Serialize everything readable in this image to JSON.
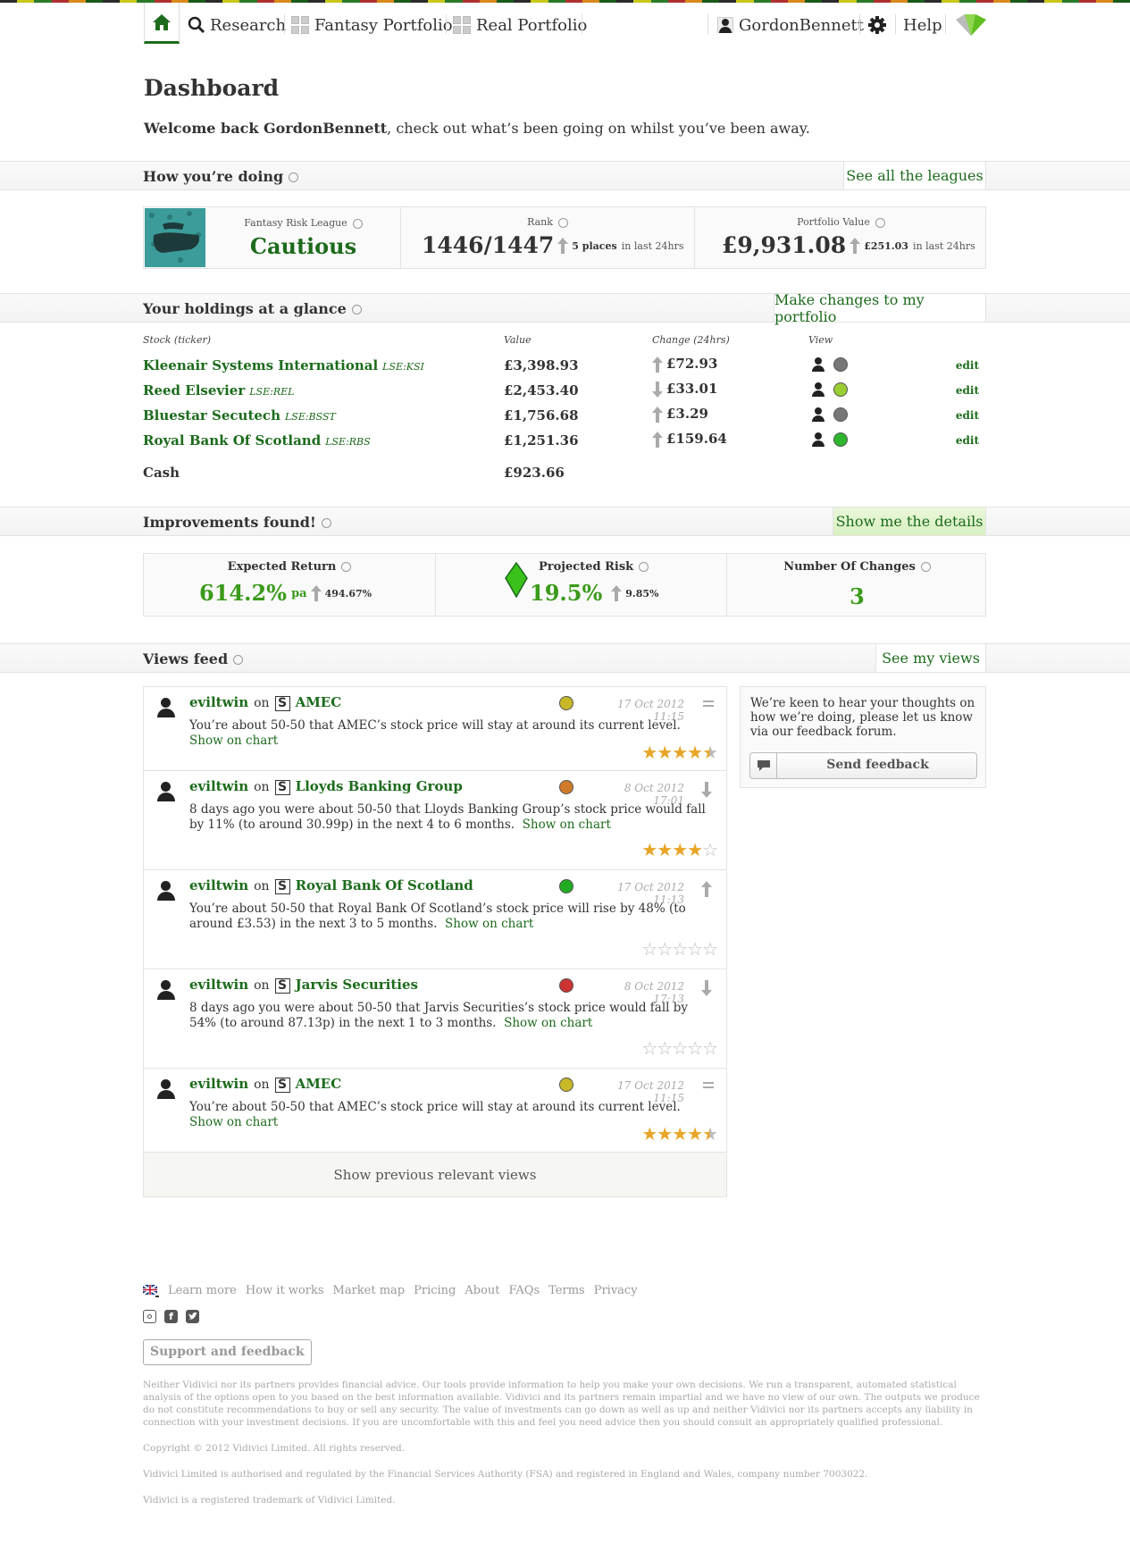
{
  "nav": {
    "research": "Research",
    "fantasy": "Fantasy Portfolio",
    "real": "Real Portfolio",
    "user": "GordonBennett",
    "help": "Help"
  },
  "page": {
    "title": "Dashboard",
    "welcome_name": "Welcome back GordonBennett",
    "welcome_rest": ", check out what’s been going on whilst you’ve been away."
  },
  "doing": {
    "header": "How you’re doing",
    "action": "See all the leagues",
    "league_label": "Fantasy Risk League",
    "league_value": "Cautious",
    "rank_label": "Rank",
    "rank_value": "1446/1447",
    "rank_change": "5 places",
    "rank_suffix": "in last 24hrs",
    "pv_label": "Portfolio Value",
    "pv_value": "£9,931.08",
    "pv_change": "£251.03",
    "pv_suffix": "in last 24hrs"
  },
  "holdings": {
    "header": "Your holdings at a glance",
    "action": "Make changes to my portfolio",
    "col_stock": "Stock (ticker)",
    "col_value": "Value",
    "col_change": "Change (24hrs)",
    "col_view": "View",
    "edit": "edit",
    "rows": [
      {
        "name": "Kleenair Systems International",
        "ticker": "LSE:KSI",
        "value": "£3,398.93",
        "change": "£72.93",
        "dir": "up",
        "dot": "#777777"
      },
      {
        "name": "Reed Elsevier",
        "ticker": "LSE:REL",
        "value": "£2,453.40",
        "change": "£33.01",
        "dir": "down",
        "dot": "#9acd32"
      },
      {
        "name": "Bluestar Secutech",
        "ticker": "LSE:BSST",
        "value": "£1,756.68",
        "change": "£3.29",
        "dir": "up",
        "dot": "#777777"
      },
      {
        "name": "Royal Bank Of Scotland",
        "ticker": "LSE:RBS",
        "value": "£1,251.36",
        "change": "£159.64",
        "dir": "up",
        "dot": "#2db52d"
      }
    ],
    "cash_label": "Cash",
    "cash_value": "£923.66"
  },
  "improve": {
    "header": "Improvements found!",
    "action": "Show me the details",
    "er_label": "Expected Return",
    "er_value": "614.2%",
    "er_unit": "pa",
    "er_change": "494.67%",
    "pr_label": "Projected Risk",
    "pr_value": "19.5%",
    "pr_change": "9.85%",
    "nc_label": "Number Of Changes",
    "nc_value": "3"
  },
  "views": {
    "header": "Views feed",
    "action": "See my views",
    "on": "on",
    "show_chart": "Show on chart",
    "items": [
      {
        "user": "eviltwin",
        "stock": "AMEC",
        "date": "17 Oct 2012 11:15",
        "dot": "#c8b828",
        "action": "flat",
        "text": "You’re about 50-50 that AMEC’s stock price will stay at around its current level.",
        "stars": 4.5
      },
      {
        "user": "eviltwin",
        "stock": "Lloyds Banking Group",
        "date": "8 Oct 2012 17:01",
        "dot": "#d07a2a",
        "action": "down",
        "text": "8 days ago you were about 50-50 that Lloyds Banking Group’s stock price would fall by 11% (to around 30.99p) in the next 4 to 6 months.",
        "stars": 4
      },
      {
        "user": "eviltwin",
        "stock": "Royal Bank Of Scotland",
        "date": "17 Oct 2012 11:13",
        "dot": "#22aa22",
        "action": "up",
        "text": "You’re about 50-50 that Royal Bank Of Scotland’s stock price will rise by 48% (to around £3.53) in the next 3 to 5 months.",
        "stars": 0
      },
      {
        "user": "eviltwin",
        "stock": "Jarvis Securities",
        "date": "8 Oct 2012 17:13",
        "dot": "#cc3333",
        "action": "down",
        "text": "8 days ago you were about 50-50 that Jarvis Securities’s stock price would fall by 54% (to around 87.13p) in the next 1 to 3 months.",
        "stars": 0
      },
      {
        "user": "eviltwin",
        "stock": "AMEC",
        "date": "17 Oct 2012 11:15",
        "dot": "#c8b828",
        "action": "flat",
        "text": "You’re about 50-50 that AMEC’s stock price will stay at around its current level.",
        "stars": 4.5
      }
    ],
    "show_previous": "Show previous relevant views"
  },
  "feedback": {
    "text": "We’re keen to hear your thoughts on how we’re doing, please let us know via our feedback forum.",
    "button": "Send feedback"
  },
  "footer": {
    "links": [
      "Learn more",
      "How it works",
      "Market map",
      "Pricing",
      "About",
      "FAQs",
      "Terms",
      "Privacy"
    ],
    "support": "Support and feedback",
    "disclaimer": "Neither Vidivici nor its partners provides financial advice. Our tools provide information to help you make your own decisions. We run a transparent, automated statistical analysis of the options open to you based on the best information available. Vidivici and its partners remain impartial and we have no view of our own. The outputs we produce do not constitute recommendations to buy or sell any security. The value of investments can go down as well as up and neither Vidivici nor its partners accepts any liability in connection with your investment decisions. If you are uncomfortable with this and feel you need advice then you should consult an appropriately qualified professional.",
    "copyright": "Copyright © 2012 Vidivici Limited. All rights reserved.",
    "fsa": "Vidivici Limited is authorised and regulated by the Financial Services Authority (FSA) and registered in England and Wales, company number 7003022.",
    "trademark": "Vidivici is a registered trademark of Vidivici Limited."
  },
  "colors": {
    "brand_green": "#1c6b1c",
    "value_green": "#3a9a1a",
    "star": "#e8a526"
  }
}
